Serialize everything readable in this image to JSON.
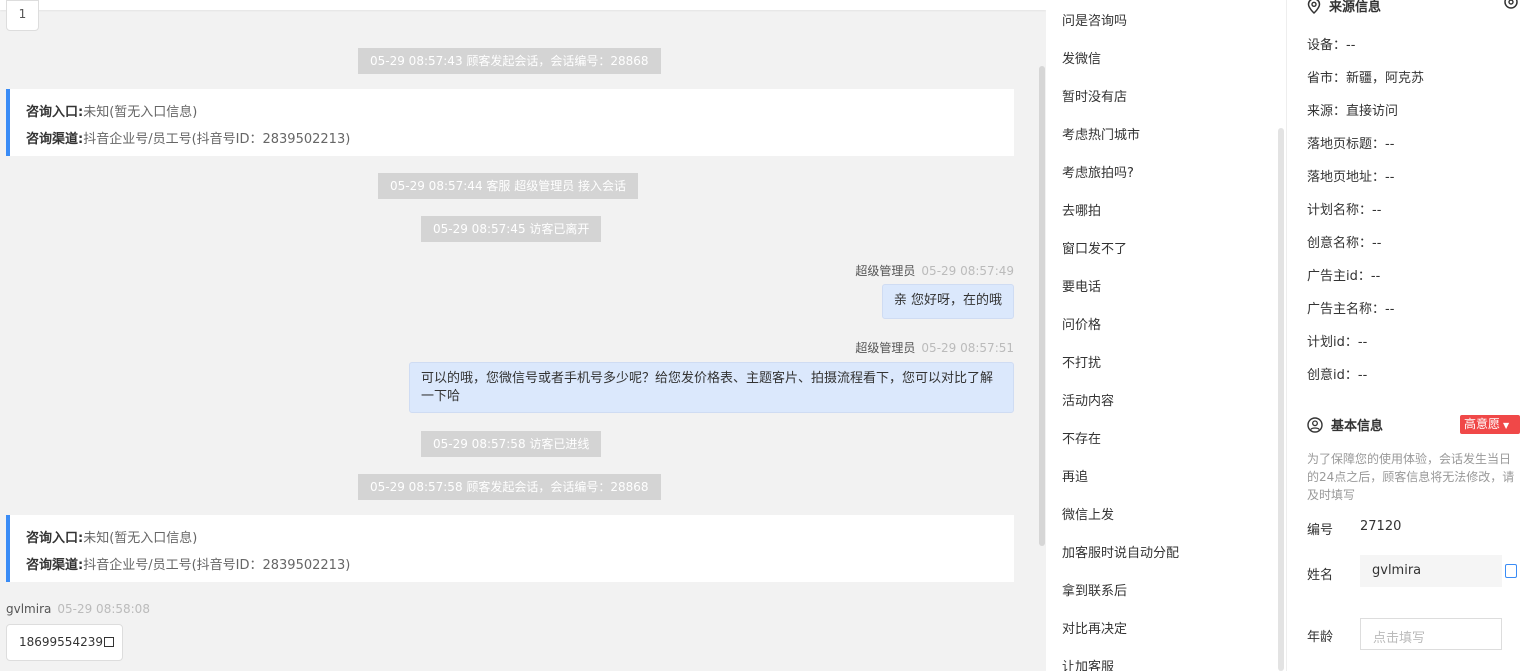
{
  "pager": {
    "current": "1"
  },
  "chat": {
    "events": [
      "05-29 08:57:43 顾客发起会话，会话编号：28868",
      "05-29 08:57:44 客服 超级管理员 接入会话",
      "05-29 08:57:45 访客已离开",
      "05-29 08:57:58 访客已进线",
      "05-29 08:57:58 顾客发起会话，会话编号：28868"
    ],
    "entry_cards": [
      {
        "entry_label": "咨询入口:",
        "entry_value": "未知(暂无入口信息)",
        "channel_label": "咨询渠道:",
        "channel_value": "抖音企业号/员工号(抖音号ID：2839502213)"
      },
      {
        "entry_label": "咨询入口:",
        "entry_value": "未知(暂无入口信息)",
        "channel_label": "咨询渠道:",
        "channel_value": "抖音企业号/员工号(抖音号ID：2839502213)"
      }
    ],
    "messages": [
      {
        "sender": "超级管理员",
        "time": "05-29 08:57:49",
        "text": "亲 您好呀，在的哦"
      },
      {
        "sender": "超级管理员",
        "time": "05-29 08:57:51",
        "text": "可以的哦，您微信号或者手机号多少呢？给您发价格表、主题客片、拍摄流程看下，您可以对比了解一下哈"
      }
    ],
    "visitor": {
      "name": "gvlmira",
      "time": "05-29 08:58:08",
      "phone": "18699554239"
    }
  },
  "quick_replies": [
    "问是咨询吗",
    "发微信",
    "暂时没有店",
    "考虑热门城市",
    "考虑旅拍吗?",
    "去哪拍",
    "窗口发不了",
    "要电话",
    "问价格",
    "不打扰",
    "活动内容",
    "不存在",
    "再追",
    "微信上发",
    "加客服时说自动分配",
    "拿到联系后",
    "对比再决定",
    "让加客服"
  ],
  "source_info": {
    "title": "来源信息",
    "rows": [
      {
        "label": "设备：",
        "value": "--"
      },
      {
        "label": "省市：",
        "value": "新疆，阿克苏"
      },
      {
        "label": "来源：",
        "value": "直接访问"
      },
      {
        "label": "落地页标题：",
        "value": "--"
      },
      {
        "label": "落地页地址：",
        "value": "--"
      },
      {
        "label": "计划名称：",
        "value": "--"
      },
      {
        "label": "创意名称：",
        "value": "--"
      },
      {
        "label": "广告主id：",
        "value": "--"
      },
      {
        "label": "广告主名称：",
        "value": "--"
      },
      {
        "label": "计划id：",
        "value": "--"
      },
      {
        "label": "创意id：",
        "value": "--"
      }
    ]
  },
  "basic_info": {
    "title": "基本信息",
    "intent_badge": "高意愿",
    "note": "为了保障您的使用体验，会话发生当日的24点之后，顾客信息将无法修改，请及时填写",
    "id_label": "编号",
    "id_value": "27120",
    "name_label": "姓名",
    "name_value": "gvlmira",
    "age_label": "年龄",
    "age_placeholder": "点击填写"
  },
  "colors": {
    "accent": "#3a8cf6",
    "badge_red": "#f04848",
    "bubble": "#dbe8fc",
    "system_msg": "#d4d4d4"
  }
}
